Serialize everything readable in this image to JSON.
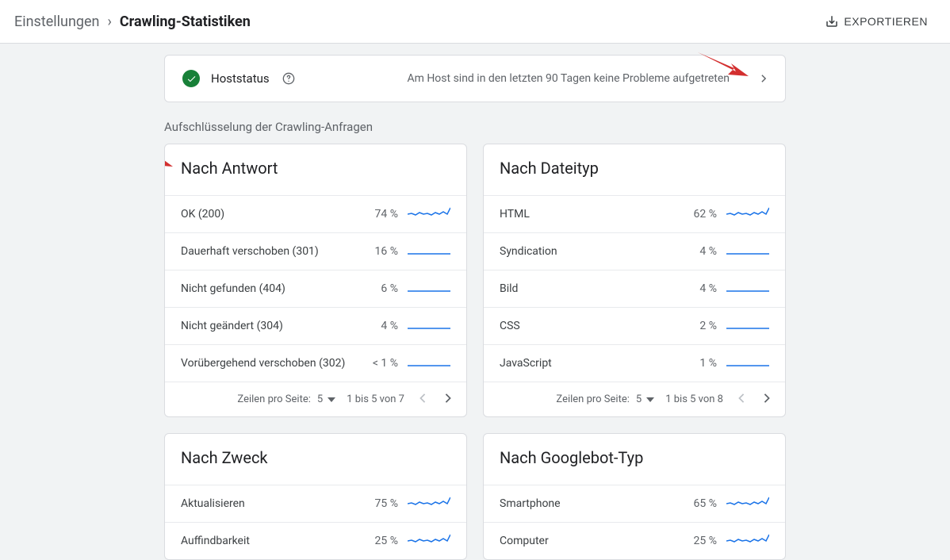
{
  "breadcrumb": {
    "page": "Einstellungen",
    "current": "Crawling-Statistiken"
  },
  "export_label": "EXPORTIEREN",
  "host": {
    "label": "Hoststatus",
    "message": "Am Host sind in den letzten 90 Tagen keine Probleme aufgetreten"
  },
  "section_title": "Aufschlüsselung der Crawling-Anfragen",
  "footer": {
    "rows_per_page_label": "Zeilen pro Seite:",
    "page_size": "5"
  },
  "cards": {
    "response": {
      "title": "Nach Antwort",
      "range": "1 bis 5 von 7",
      "rows": [
        {
          "label": "OK (200)",
          "pct": "74 %",
          "spark": "wiggly"
        },
        {
          "label": "Dauerhaft verschoben (301)",
          "pct": "16 %",
          "spark": "flat"
        },
        {
          "label": "Nicht gefunden (404)",
          "pct": "6 %",
          "spark": "flat"
        },
        {
          "label": "Nicht geändert (304)",
          "pct": "4 %",
          "spark": "flat"
        },
        {
          "label": "Vorübergehend verschoben (302)",
          "pct": "< 1 %",
          "spark": "flat"
        }
      ]
    },
    "filetype": {
      "title": "Nach Dateityp",
      "range": "1 bis 5 von 8",
      "rows": [
        {
          "label": "HTML",
          "pct": "62 %",
          "spark": "wiggly"
        },
        {
          "label": "Syndication",
          "pct": "4 %",
          "spark": "flat"
        },
        {
          "label": "Bild",
          "pct": "4 %",
          "spark": "flat"
        },
        {
          "label": "CSS",
          "pct": "2 %",
          "spark": "flat"
        },
        {
          "label": "JavaScript",
          "pct": "1 %",
          "spark": "flat"
        }
      ]
    },
    "purpose": {
      "title": "Nach Zweck",
      "rows": [
        {
          "label": "Aktualisieren",
          "pct": "75 %",
          "spark": "wiggly"
        },
        {
          "label": "Auffindbarkeit",
          "pct": "25 %",
          "spark": "wiggly"
        }
      ]
    },
    "googlebot": {
      "title": "Nach Googlebot-Typ",
      "rows": [
        {
          "label": "Smartphone",
          "pct": "65 %",
          "spark": "wiggly"
        },
        {
          "label": "Computer",
          "pct": "25 %",
          "spark": "wiggly"
        }
      ]
    }
  }
}
